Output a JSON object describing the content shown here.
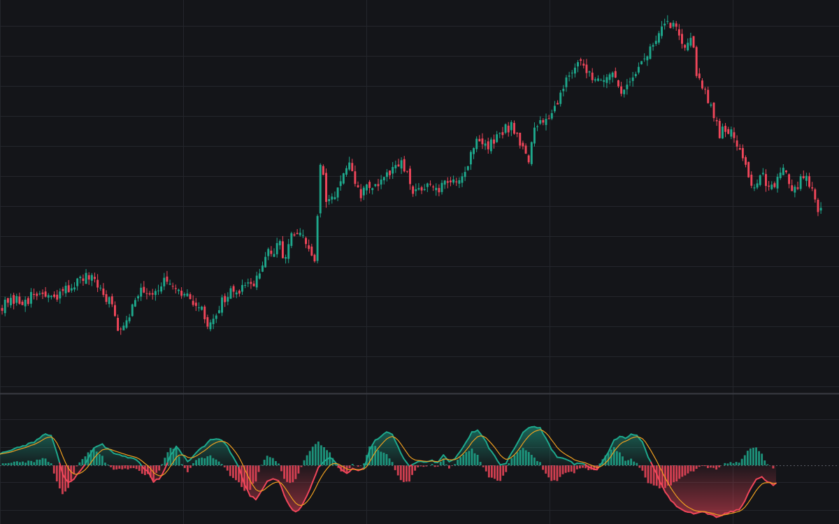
{
  "chart_data": [
    {
      "type": "candlestick",
      "title": "",
      "xlabel": "",
      "ylabel": "",
      "grid": true,
      "colors": {
        "background": "#141519",
        "grid": "#24262c",
        "up": "#1ea88c",
        "down": "#f0465a"
      },
      "ylim": [
        0,
        200
      ],
      "close_path": [
        [
          0,
          44
        ],
        [
          6,
          46
        ],
        [
          10,
          48
        ],
        [
          14,
          50
        ],
        [
          18,
          46
        ],
        [
          22,
          52
        ],
        [
          26,
          56
        ],
        [
          30,
          58
        ],
        [
          34,
          52
        ],
        [
          38,
          44
        ],
        [
          40,
          32
        ],
        [
          43,
          38
        ],
        [
          46,
          46
        ],
        [
          48,
          54
        ],
        [
          51,
          50
        ],
        [
          56,
          56
        ],
        [
          60,
          50
        ],
        [
          64,
          48
        ],
        [
          68,
          44
        ],
        [
          71,
          34
        ],
        [
          73,
          38
        ],
        [
          76,
          46
        ],
        [
          79,
          50
        ],
        [
          84,
          52
        ],
        [
          88,
          58
        ],
        [
          92,
          70
        ],
        [
          96,
          74
        ],
        [
          98,
          68
        ],
        [
          100,
          80
        ],
        [
          104,
          78
        ],
        [
          108,
          66
        ],
        [
          110,
          114
        ],
        [
          111,
          108
        ],
        [
          112,
          96
        ],
        [
          116,
          104
        ],
        [
          118,
          110
        ],
        [
          120,
          114
        ],
        [
          124,
          100
        ],
        [
          126,
          106
        ],
        [
          128,
          104
        ],
        [
          132,
          108
        ],
        [
          136,
          114
        ],
        [
          138,
          116
        ],
        [
          140,
          110
        ],
        [
          142,
          100
        ],
        [
          146,
          106
        ],
        [
          150,
          102
        ],
        [
          156,
          108
        ],
        [
          160,
          112
        ],
        [
          164,
          130
        ],
        [
          168,
          124
        ],
        [
          172,
          132
        ],
        [
          176,
          136
        ],
        [
          180,
          126
        ],
        [
          182,
          116
        ],
        [
          184,
          134
        ],
        [
          188,
          140
        ],
        [
          192,
          148
        ],
        [
          196,
          164
        ],
        [
          200,
          166
        ],
        [
          202,
          164
        ],
        [
          206,
          160
        ],
        [
          210,
          162
        ],
        [
          214,
          154
        ],
        [
          216,
          158
        ],
        [
          220,
          166
        ],
        [
          224,
          174
        ],
        [
          228,
          186
        ],
        [
          232,
          188
        ],
        [
          236,
          178
        ],
        [
          238,
          182
        ],
        [
          240,
          164
        ],
        [
          244,
          150
        ],
        [
          248,
          132
        ],
        [
          252,
          134
        ],
        [
          254,
          128
        ],
        [
          258,
          110
        ],
        [
          260,
          104
        ],
        [
          262,
          112
        ],
        [
          264,
          106
        ],
        [
          266,
          104
        ],
        [
          270,
          116
        ],
        [
          272,
          106
        ],
        [
          274,
          102
        ],
        [
          276,
          110
        ],
        [
          280,
          106
        ],
        [
          282,
          90
        ],
        [
          283,
          95
        ]
      ],
      "x_count": 284
    },
    {
      "type": "oscillator",
      "title": "",
      "xlabel": "",
      "ylabel": "",
      "grid": true,
      "colors": {
        "up": "#1ea88c",
        "down": "#f0465a",
        "signal": "#f0a020",
        "zero": "#5a5d66"
      },
      "ylim": [
        -10,
        10
      ],
      "zero_line": 0,
      "oscillator_path": [
        [
          0,
          2.2
        ],
        [
          6,
          3.2
        ],
        [
          12,
          4.2
        ],
        [
          16,
          5.8
        ],
        [
          18,
          5.4
        ],
        [
          20,
          2.4
        ],
        [
          22,
          -1.6
        ],
        [
          24,
          -3.2
        ],
        [
          26,
          -2.4
        ],
        [
          28,
          -1.2
        ],
        [
          30,
          0.2
        ],
        [
          33,
          3.2
        ],
        [
          36,
          3.8
        ],
        [
          40,
          2.2
        ],
        [
          44,
          1.6
        ],
        [
          48,
          1.0
        ],
        [
          52,
          -1.2
        ],
        [
          54,
          -3.0
        ],
        [
          56,
          -2.4
        ],
        [
          58,
          -0.8
        ],
        [
          60,
          1.8
        ],
        [
          62,
          3.6
        ],
        [
          64,
          2.0
        ],
        [
          66,
          0.8
        ],
        [
          68,
          1.6
        ],
        [
          70,
          2.8
        ],
        [
          72,
          3.6
        ],
        [
          74,
          4.8
        ],
        [
          78,
          4.6
        ],
        [
          80,
          3.4
        ],
        [
          82,
          1.6
        ],
        [
          84,
          -0.4
        ],
        [
          86,
          -3.4
        ],
        [
          88,
          -5.6
        ],
        [
          90,
          -6.2
        ],
        [
          92,
          -4.6
        ],
        [
          94,
          -3.0
        ],
        [
          96,
          -2.6
        ],
        [
          98,
          -2.8
        ],
        [
          100,
          -5.4
        ],
        [
          102,
          -7.6
        ],
        [
          104,
          -8.6
        ],
        [
          106,
          -7.6
        ],
        [
          108,
          -5.6
        ],
        [
          110,
          -3.0
        ],
        [
          112,
          -0.4
        ],
        [
          114,
          0.8
        ],
        [
          116,
          1.4
        ],
        [
          118,
          0.6
        ],
        [
          120,
          -0.8
        ],
        [
          122,
          -1.4
        ],
        [
          124,
          -0.6
        ],
        [
          126,
          -1.0
        ],
        [
          128,
          -0.6
        ],
        [
          130,
          2.8
        ],
        [
          132,
          4.6
        ],
        [
          134,
          5.2
        ],
        [
          136,
          6.2
        ],
        [
          138,
          5.6
        ],
        [
          140,
          3.4
        ],
        [
          142,
          1.2
        ],
        [
          144,
          -0.2
        ],
        [
          146,
          0.4
        ],
        [
          148,
          0.8
        ],
        [
          150,
          0.6
        ],
        [
          152,
          0.8
        ],
        [
          154,
          0.4
        ],
        [
          156,
          1.8
        ],
        [
          158,
          0.8
        ],
        [
          160,
          1.2
        ],
        [
          162,
          2.6
        ],
        [
          164,
          4.4
        ],
        [
          166,
          6.0
        ],
        [
          168,
          6.4
        ],
        [
          170,
          5.2
        ],
        [
          172,
          3.2
        ],
        [
          174,
          1.6
        ],
        [
          176,
          0.2
        ],
        [
          178,
          0.4
        ],
        [
          180,
          2.2
        ],
        [
          182,
          4.2
        ],
        [
          184,
          6.0
        ],
        [
          186,
          7.0
        ],
        [
          188,
          7.2
        ],
        [
          190,
          6.8
        ],
        [
          192,
          5.0
        ],
        [
          194,
          3.0
        ],
        [
          196,
          1.6
        ],
        [
          198,
          1.2
        ],
        [
          200,
          1.0
        ],
        [
          202,
          0.2
        ],
        [
          204,
          0.4
        ],
        [
          206,
          0.2
        ],
        [
          208,
          -0.6
        ],
        [
          210,
          -0.8
        ],
        [
          212,
          0.8
        ],
        [
          214,
          2.4
        ],
        [
          216,
          4.6
        ],
        [
          218,
          5.2
        ],
        [
          220,
          5.0
        ],
        [
          222,
          5.8
        ],
        [
          224,
          5.4
        ],
        [
          226,
          4.2
        ],
        [
          228,
          1.6
        ],
        [
          230,
          -0.6
        ],
        [
          232,
          -2.8
        ],
        [
          234,
          -5.0
        ],
        [
          236,
          -6.4
        ],
        [
          238,
          -7.4
        ],
        [
          240,
          -8.2
        ],
        [
          244,
          -8.8
        ],
        [
          248,
          -8.6
        ],
        [
          252,
          -9.4
        ],
        [
          256,
          -8.8
        ],
        [
          260,
          -8.0
        ],
        [
          262,
          -6.6
        ],
        [
          264,
          -4.4
        ],
        [
          266,
          -2.6
        ],
        [
          268,
          -2.2
        ],
        [
          270,
          -3.0
        ],
        [
          272,
          -3.6
        ],
        [
          273,
          -3.4
        ]
      ],
      "signal_smoothing": 6
    }
  ]
}
